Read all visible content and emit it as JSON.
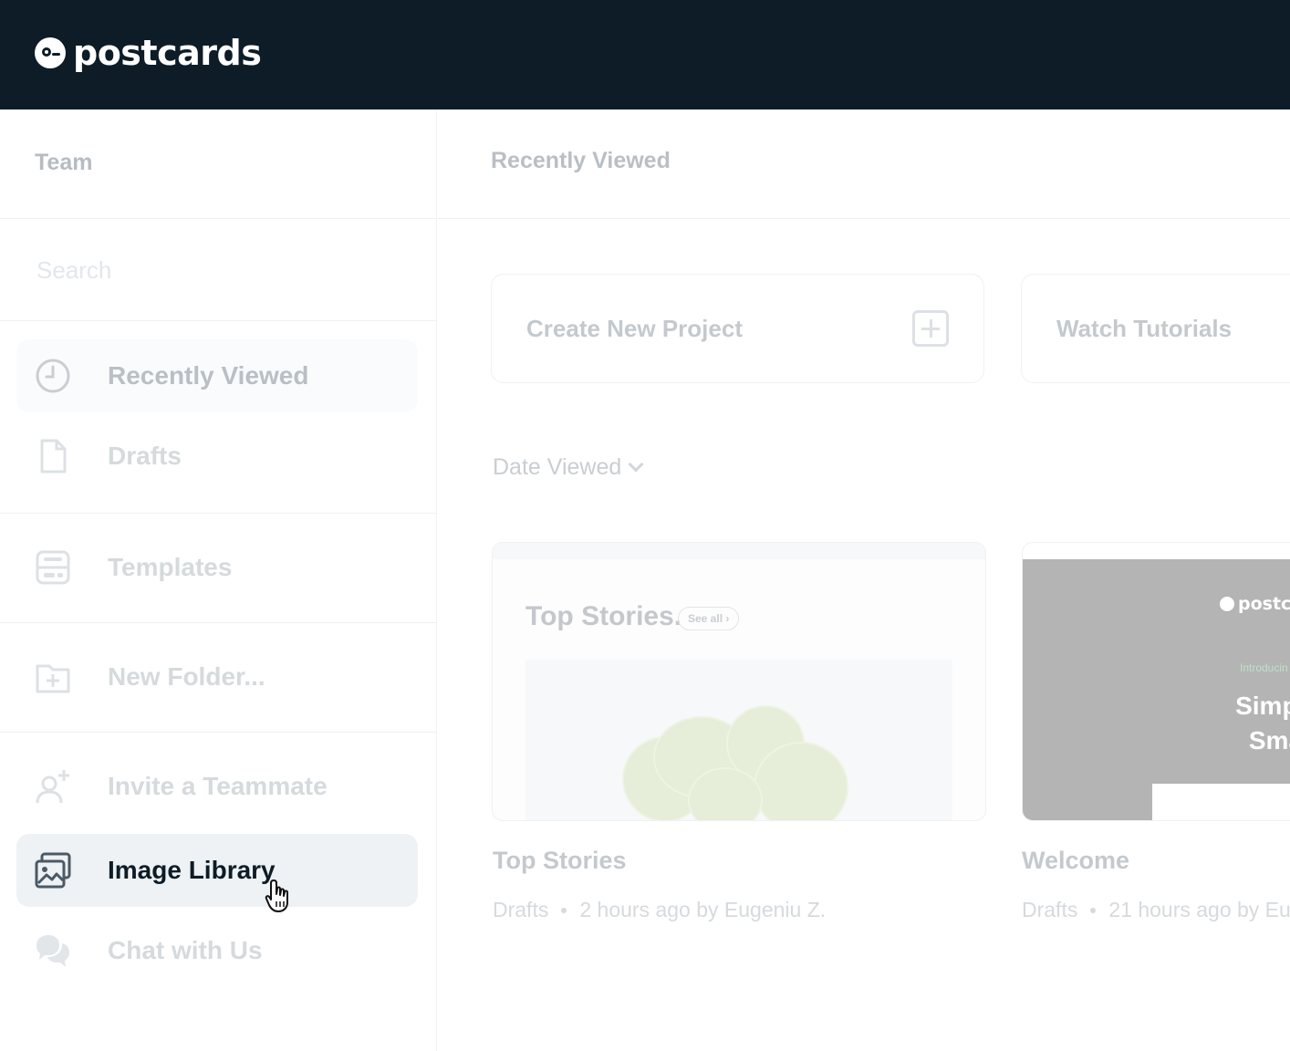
{
  "header": {
    "brand": "postcards"
  },
  "sidebar": {
    "team_label": "Team",
    "search_placeholder": "Search",
    "items": [
      {
        "label": "Recently Viewed",
        "icon": "clock-icon"
      },
      {
        "label": "Drafts",
        "icon": "document-icon"
      },
      {
        "label": "Templates",
        "icon": "templates-icon"
      },
      {
        "label": "New Folder...",
        "icon": "folder-plus-icon"
      },
      {
        "label": "Invite a Teammate",
        "icon": "user-plus-icon"
      },
      {
        "label": "Image Library",
        "icon": "image-library-icon",
        "active": true
      },
      {
        "label": "Chat with Us",
        "icon": "chat-icon"
      }
    ]
  },
  "main": {
    "title": "Recently Viewed",
    "actions": [
      {
        "label": "Create New Project"
      },
      {
        "label": "Watch Tutorials"
      }
    ],
    "sort_label": "Date Viewed",
    "projects": [
      {
        "name": "Top Stories",
        "folder": "Drafts",
        "meta": "2 hours ago by Eugeniu Z.",
        "preview": {
          "title": "Top Stories.",
          "link": "See all"
        }
      },
      {
        "name": "Welcome",
        "folder": "Drafts",
        "meta": "21 hours ago by Eu",
        "preview": {
          "brand": "postca",
          "intro": "Introducin",
          "headline_1": "Simple po",
          "headline_2": "Smart b"
        }
      }
    ]
  },
  "colors": {
    "topbar": "#0d1c26",
    "active_bg": "#eef2f5",
    "active_text": "#0d1c26"
  }
}
